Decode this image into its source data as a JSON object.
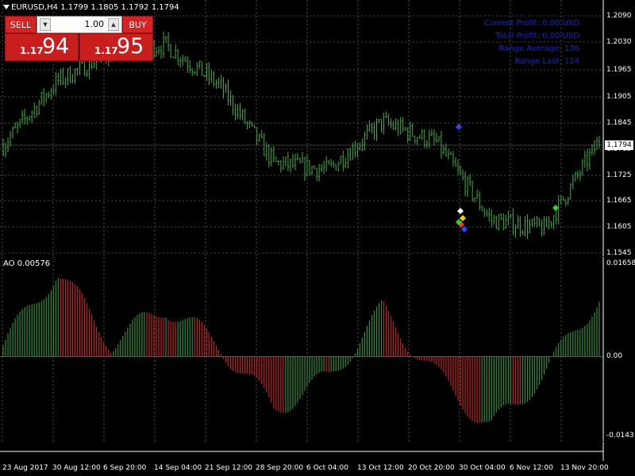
{
  "chart": {
    "title": "EURUSD,H4  1.1799 1.1805 1.1792 1.1794",
    "current_price_label": "1.1794",
    "price_axis": [
      "1.2090",
      "1.2030",
      "1.1965",
      "1.1905",
      "1.1845",
      "1.1785",
      "1.1725",
      "1.1665",
      "1.1605",
      "1.1545"
    ],
    "info_lines": [
      "Current Profit: 0.00 USD",
      "Total Profit: 0.00 USD",
      "Range Average: 136",
      "Range Last: 114"
    ]
  },
  "trade_panel": {
    "sell_label": "SELL",
    "buy_label": "BUY",
    "lot_value": "1.00",
    "sell_small": "1.17",
    "sell_big": "94",
    "buy_small": "1.17",
    "buy_big": "95"
  },
  "ao": {
    "label": "AO 0.00576",
    "axis": [
      "0.01658",
      "0.00",
      "-0.0143"
    ]
  },
  "time_axis": [
    "23 Aug 2017",
    "30 Aug 12:00",
    "6 Sep 20:00",
    "14 Sep 04:00",
    "21 Sep 12:00",
    "28 Sep 20:00",
    "6 Oct 04:00",
    "13 Oct 12:00",
    "20 Oct 20:00",
    "30 Oct 04:00",
    "6 Nov 12:00",
    "13 Nov 20:00"
  ],
  "colors": {
    "background": "#000000",
    "candle": "#3fae3f",
    "ao_up": "#2f8f3a",
    "ao_down": "#c42222",
    "panel_red": "#d62424",
    "info_text": "#1a20d8"
  },
  "chart_data": [
    {
      "type": "line",
      "name": "EURUSD,H4 price",
      "x": [
        "23 Aug 2017",
        "30 Aug 12:00",
        "6 Sep 20:00",
        "14 Sep 04:00",
        "21 Sep 12:00",
        "28 Sep 20:00",
        "6 Oct 04:00",
        "13 Oct 12:00",
        "20 Oct 20:00",
        "30 Oct 04:00",
        "6 Nov 12:00",
        "13 Nov 20:00"
      ],
      "values": [
        1.1785,
        1.1925,
        1.199,
        1.2005,
        1.1915,
        1.1745,
        1.173,
        1.1835,
        1.179,
        1.162,
        1.16,
        1.1794
      ],
      "ylim": [
        1.1545,
        1.209
      ]
    },
    {
      "type": "bar",
      "name": "AO",
      "x": [
        "23 Aug 2017",
        "30 Aug 12:00",
        "6 Sep 20:00",
        "14 Sep 04:00",
        "21 Sep 12:00",
        "28 Sep 20:00",
        "6 Oct 04:00",
        "13 Oct 12:00",
        "20 Oct 20:00",
        "30 Oct 04:00",
        "6 Nov 12:00",
        "13 Nov 20:00"
      ],
      "values": [
        0.002,
        0.0155,
        0.0025,
        0.009,
        0.002,
        -0.0095,
        -0.004,
        0.0085,
        -0.0035,
        -0.013,
        -0.003,
        0.011
      ],
      "ylim": [
        -0.0143,
        0.01658
      ]
    }
  ]
}
